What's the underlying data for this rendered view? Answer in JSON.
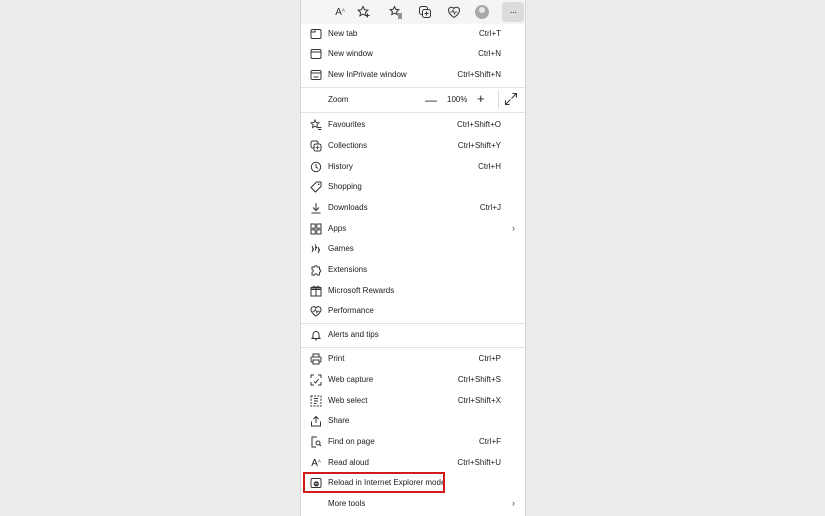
{
  "colors": {
    "highlight": "#d11a1a",
    "panel_bg": "#ffffff",
    "page_bg": "#ececec"
  },
  "toolbar": {
    "icons": [
      "read-aloud-icon",
      "add-favorite-icon",
      "favorites-icon",
      "collections-icon",
      "browser-essentials-icon",
      "profile-avatar",
      "more-options-icon"
    ],
    "read_aloud_glyph": "A",
    "more_glyph": "···"
  },
  "menu": {
    "new_tab": {
      "label": "New tab",
      "shortcut": "Ctrl+T",
      "icon": "new-tab-icon"
    },
    "new_window": {
      "label": "New window",
      "shortcut": "Ctrl+N",
      "icon": "new-window-icon"
    },
    "new_inprivate": {
      "label": "New InPrivate window",
      "shortcut": "Ctrl+Shift+N",
      "icon": "inprivate-icon"
    },
    "zoom": {
      "label": "Zoom",
      "minus": "—",
      "value": "100%",
      "plus": "+"
    },
    "favourites": {
      "label": "Favourites",
      "shortcut": "Ctrl+Shift+O",
      "icon": "favourites-icon"
    },
    "collections": {
      "label": "Collections",
      "shortcut": "Ctrl+Shift+Y",
      "icon": "collections-icon"
    },
    "history": {
      "label": "History",
      "shortcut": "Ctrl+H",
      "icon": "history-icon"
    },
    "shopping": {
      "label": "Shopping",
      "icon": "shopping-tag-icon"
    },
    "downloads": {
      "label": "Downloads",
      "shortcut": "Ctrl+J",
      "icon": "download-icon"
    },
    "apps": {
      "label": "Apps",
      "icon": "apps-icon",
      "chevron": "›"
    },
    "games": {
      "label": "Games",
      "icon": "games-icon"
    },
    "extensions": {
      "label": "Extensions",
      "icon": "extensions-icon"
    },
    "rewards": {
      "label": "Microsoft Rewards",
      "icon": "rewards-icon"
    },
    "performance": {
      "label": "Performance",
      "icon": "performance-icon"
    },
    "alerts": {
      "label": "Alerts and tips",
      "icon": "bell-icon"
    },
    "print": {
      "label": "Print",
      "shortcut": "Ctrl+P",
      "icon": "print-icon"
    },
    "web_capture": {
      "label": "Web capture",
      "shortcut": "Ctrl+Shift+S",
      "icon": "web-capture-icon"
    },
    "web_select": {
      "label": "Web select",
      "shortcut": "Ctrl+Shift+X",
      "icon": "web-select-icon"
    },
    "share": {
      "label": "Share",
      "icon": "share-icon"
    },
    "find": {
      "label": "Find on page",
      "shortcut": "Ctrl+F",
      "icon": "find-icon"
    },
    "read_aloud": {
      "label": "Read aloud",
      "shortcut": "Ctrl+Shift+U",
      "icon": "read-aloud-icon",
      "glyph": "A"
    },
    "ie_mode": {
      "label": "Reload in Internet Explorer mode",
      "icon": "ie-mode-icon"
    },
    "more_tools": {
      "label": "More tools",
      "chevron": "›"
    }
  }
}
